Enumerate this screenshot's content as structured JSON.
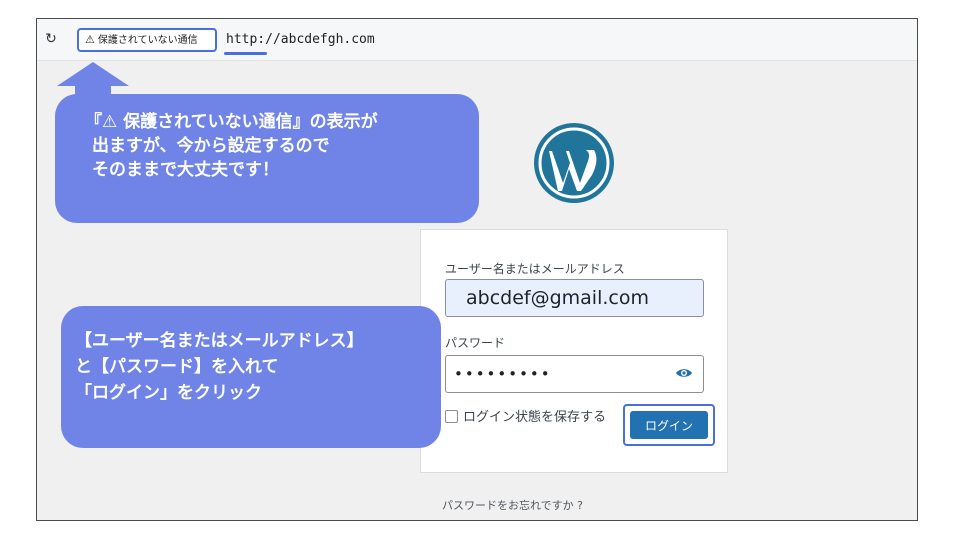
{
  "browser": {
    "reload_icon": "reload-icon",
    "security_warning_icon": "warning-triangle-icon",
    "security_label": "保護されていない通信",
    "url": "http://abcdefgh.com"
  },
  "callouts": {
    "top": {
      "line1": "『⚠ 保護されていない通信』の表示が",
      "line2": "出ますが、今から設定するので",
      "line3": "そのままで大丈夫です！"
    },
    "bottom": {
      "line1": "【ユーザー名またはメールアドレス】",
      "line2": "と【パスワード】を入れて",
      "line3": "「ログイン」をクリック"
    }
  },
  "login": {
    "logo_icon": "wordpress-logo-icon",
    "username_label": "ユーザー名またはメールアドレス",
    "username_value": "abcdef@gmail.com",
    "password_label": "パスワード",
    "password_value": "•••••••••",
    "show_password_icon": "eye-icon",
    "remember_label": "ログイン状態を保存する",
    "login_button": "ログイン",
    "forgot_link": "パスワードをお忘れですか ?"
  },
  "colors": {
    "callout": "#6f84e6",
    "highlight_border": "#4a6ee0",
    "wp_blue": "#2271b1",
    "wp_logo": "#21759b",
    "autofill_bg": "#e8f0fe"
  }
}
